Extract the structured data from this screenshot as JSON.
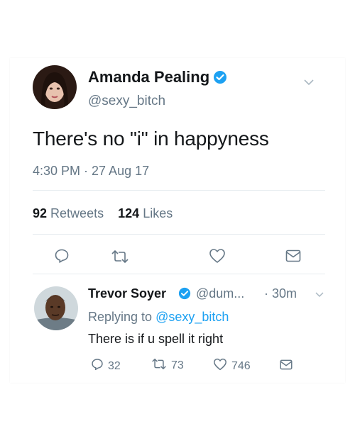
{
  "tweet": {
    "author_name": "Amanda Pealing",
    "handle": "@sexy_bitch",
    "text": "There's no \"i\" in happyness",
    "timestamp": "4:30 PM · 27 Aug 17",
    "retweets_count": "92",
    "retweets_label": "Retweets",
    "likes_count": "124",
    "likes_label": "Likes"
  },
  "reply": {
    "author_name": "Trevor Soyer",
    "handle": "@dum...",
    "time": "· 30m",
    "replying_prefix": "Replying to",
    "replying_to": "@sexy_bitch",
    "text": "There is if u spell it right",
    "reply_count": "32",
    "retweet_count": "73",
    "like_count": "746"
  },
  "icons": {
    "verified": "verified-badge-icon",
    "caret": "chevron-down-icon",
    "reply": "reply-icon",
    "retweet": "retweet-icon",
    "like": "heart-icon",
    "message": "envelope-icon"
  },
  "colors": {
    "accent": "#1da1f2",
    "secondary_text": "#657786",
    "divider": "#e6ecf0"
  }
}
